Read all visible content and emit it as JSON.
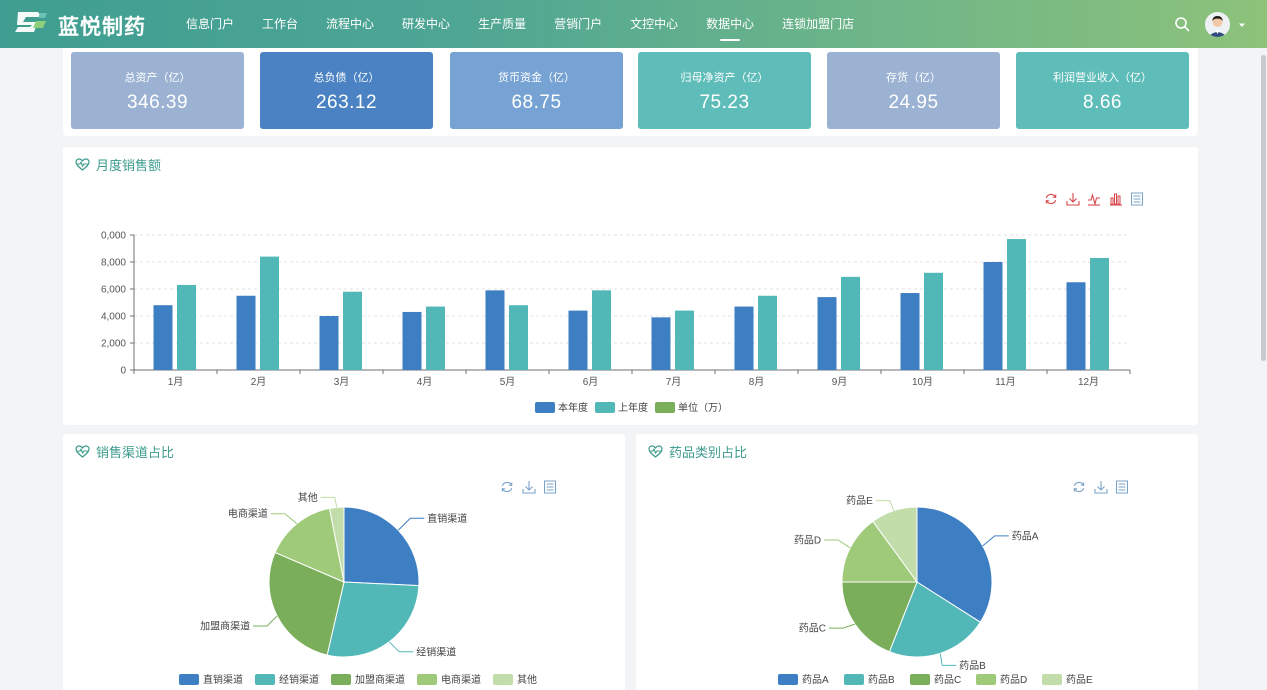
{
  "brand": {
    "name": "蓝悦制药"
  },
  "nav": {
    "items": [
      {
        "label": "信息门户"
      },
      {
        "label": "工作台"
      },
      {
        "label": "流程中心"
      },
      {
        "label": "研发中心"
      },
      {
        "label": "生产质量"
      },
      {
        "label": "营销门户"
      },
      {
        "label": "文控中心"
      },
      {
        "label": "数据中心",
        "active": true
      },
      {
        "label": "连锁加盟门店"
      }
    ],
    "icons": [
      "search-icon",
      "user-avatar",
      "chevron-down-icon"
    ]
  },
  "kpis": [
    {
      "label": "总资产（亿）",
      "value": "346.39",
      "color": "#9cb2d3"
    },
    {
      "label": "总负债（亿）",
      "value": "263.12",
      "color": "#4a82c3"
    },
    {
      "label": "货币资金（亿）",
      "value": "68.75",
      "color": "#77a3d4"
    },
    {
      "label": "归母净资产（亿）",
      "value": "75.23",
      "color": "#5ebdb9"
    },
    {
      "label": "存货（亿）",
      "value": "24.95",
      "color": "#9cb2d3"
    },
    {
      "label": "利润营业收入（亿）",
      "value": "8.66",
      "color": "#5ebdb9"
    }
  ],
  "monthly_panel": {
    "title": "月度销售额",
    "toolbox": [
      "refresh-icon",
      "download-icon",
      "line-chart-icon",
      "bar-chart-icon",
      "data-view-icon"
    ]
  },
  "channel_panel": {
    "title": "销售渠道占比",
    "toolbox": [
      "refresh-icon",
      "download-icon",
      "data-view-icon"
    ]
  },
  "category_panel": {
    "title": "药品类别占比",
    "toolbox": [
      "refresh-icon",
      "download-icon",
      "data-view-icon"
    ]
  },
  "colors": {
    "blue": "#3e7fc4",
    "teal": "#52b8b7",
    "green": "#7aae5b",
    "light_green": "#9fca7a",
    "pale_green": "#c3ddaa",
    "toolbox_active": "#d9464a",
    "toolbox": "#7aa3c8",
    "title": "#3c9b8c"
  },
  "chart_data": [
    {
      "type": "bar",
      "categories": [
        "1月",
        "2月",
        "3月",
        "4月",
        "5月",
        "6月",
        "7月",
        "8月",
        "9月",
        "10月",
        "11月",
        "12月"
      ],
      "series": [
        {
          "name": "本年度",
          "values": [
            4800,
            5500,
            4000,
            4300,
            5900,
            4400,
            3900,
            4700,
            5400,
            5700,
            8000,
            6500
          ]
        },
        {
          "name": "上年度",
          "values": [
            6300,
            8400,
            5800,
            4700,
            4800,
            5900,
            4400,
            5500,
            6900,
            7200,
            9700,
            8300
          ]
        },
        {
          "name": "单位（万）",
          "values": []
        }
      ],
      "yticks": [
        "0",
        "2,000",
        "4,000",
        "6,000",
        "8,000",
        "0,000"
      ],
      "ylim": [
        0,
        10000
      ],
      "grid": true,
      "legend": "bottom-center"
    },
    {
      "type": "pie",
      "labels": [
        "直销渠道",
        "经销渠道",
        "加盟商渠道",
        "电商渠道",
        "其他"
      ],
      "values": [
        25,
        27,
        27,
        15,
        3
      ],
      "legend": "bottom-center"
    },
    {
      "type": "pie",
      "labels": [
        "药品A",
        "药品B",
        "药品C",
        "药品D",
        "药品E"
      ],
      "values": [
        34,
        22,
        19,
        15,
        10
      ],
      "legend": "bottom-center"
    }
  ]
}
